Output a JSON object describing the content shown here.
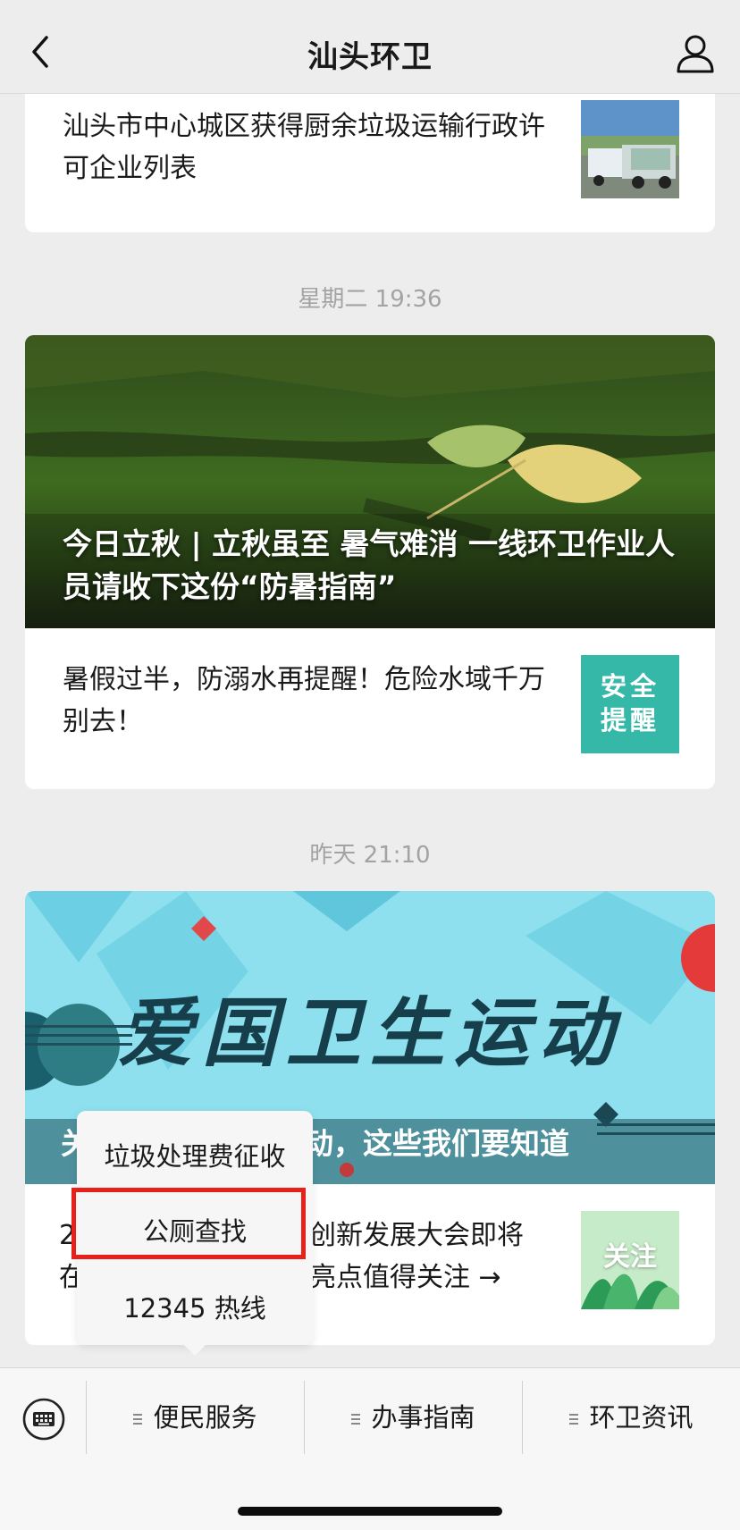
{
  "header": {
    "title": "汕头环卫",
    "back_icon": "chevron-left-icon",
    "profile_icon": "person-icon"
  },
  "articles_group1": {
    "item": {
      "text": "汕头市中心城区获得厨余垃圾运输行政许可企业列表",
      "thumb_desc": "garbage-trucks-photo"
    }
  },
  "group2": {
    "time": "星期二 19:36",
    "hero_title": "今日立秋 | 立秋虽至 暑气难消 一线环卫作业人员请收下这份“防暑指南”",
    "item": {
      "text": "暑假过半，防溺水再提醒！危险水域千万别去！",
      "thumb_text": "安全\n提醒"
    }
  },
  "group3": {
    "time": "昨天 21:10",
    "hero_banner": "爱国卫生运动",
    "hero_caption_left": "关",
    "hero_caption_right": "动，这些我们要知道",
    "item_prefix": "2",
    "item_prefix2": "在",
    "item_text_line1": "创新发展大会即将",
    "item_text_line2": "亮点值得关注 →",
    "thumb_text": "关注"
  },
  "popup": {
    "items": [
      "垃圾处理费征收",
      "公厕查找",
      "12345 热线"
    ],
    "highlighted_index": 1
  },
  "bottom_menu": {
    "keyboard_icon": "keyboard-icon",
    "items": [
      {
        "label": "便民服务"
      },
      {
        "label": "办事指南"
      },
      {
        "label": "环卫资讯"
      }
    ]
  },
  "colors": {
    "highlight": "#e8201a",
    "safety_thumb": "#36b8a8"
  }
}
